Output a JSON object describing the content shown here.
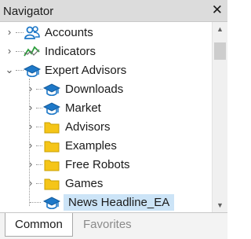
{
  "window": {
    "title": "Navigator",
    "close_icon": "close-icon"
  },
  "tree": {
    "items": [
      {
        "label": "Accounts",
        "icon": "accounts-icon",
        "expander": "collapsed"
      },
      {
        "label": "Indicators",
        "icon": "indicators-icon",
        "expander": "collapsed"
      },
      {
        "label": "Expert Advisors",
        "icon": "graduation-cap-icon",
        "expander": "expanded"
      },
      {
        "label": "Downloads",
        "icon": "graduation-cap-icon",
        "expander": "collapsed"
      },
      {
        "label": "Market",
        "icon": "graduation-cap-icon",
        "expander": "collapsed"
      },
      {
        "label": "Advisors",
        "icon": "folder-icon",
        "expander": "collapsed"
      },
      {
        "label": "Examples",
        "icon": "folder-icon",
        "expander": "collapsed"
      },
      {
        "label": "Free Robots",
        "icon": "folder-icon",
        "expander": "collapsed"
      },
      {
        "label": "Games",
        "icon": "folder-icon",
        "expander": "collapsed"
      },
      {
        "label": "News Headline_EA",
        "icon": "graduation-cap-icon",
        "expander": "none",
        "selected": true
      }
    ]
  },
  "tabs": [
    {
      "label": "Common",
      "active": true
    },
    {
      "label": "Favorites",
      "active": false
    }
  ],
  "colors": {
    "selection": "#cce4f7",
    "icon_blue": "#1e78c8",
    "folder_yellow": "#f5c518",
    "indicator_green": "#2a9d3a"
  }
}
